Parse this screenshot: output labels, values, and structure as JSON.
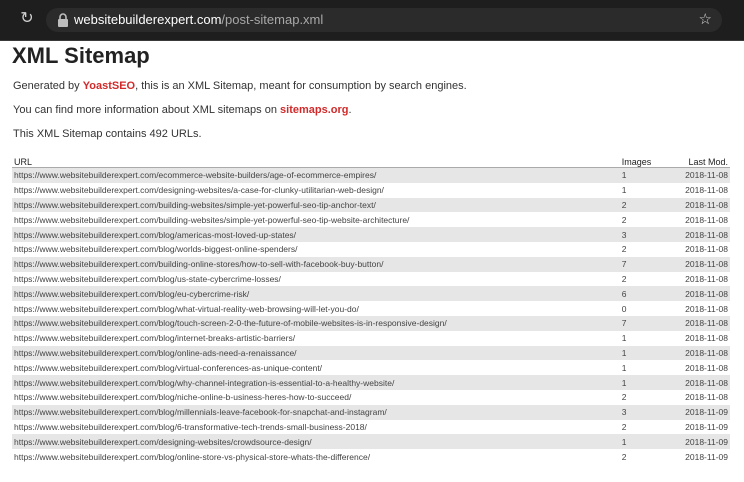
{
  "browser": {
    "url_host": "websitebuilderexpert.com",
    "url_path": "/post-sitemap.xml"
  },
  "page": {
    "title": "XML Sitemap",
    "generated_prefix": "Generated by ",
    "generated_link": "YoastSEO",
    "generated_suffix": ", this is an XML Sitemap, meant for consumption by search engines.",
    "info_prefix": "You can find more information about XML sitemaps on ",
    "info_link": "sitemaps.org",
    "info_suffix": ".",
    "count_text": "This XML Sitemap contains 492 URLs."
  },
  "table": {
    "headers": [
      "URL",
      "Images",
      "Last Mod."
    ],
    "rows": [
      {
        "url": "https://www.websitebuilderexpert.com/ecommerce-website-builders/age-of-ecommerce-empires/",
        "images": "1",
        "lastmod": "2018-11-08"
      },
      {
        "url": "https://www.websitebuilderexpert.com/designing-websites/a-case-for-clunky-utilitarian-web-design/",
        "images": "1",
        "lastmod": "2018-11-08"
      },
      {
        "url": "https://www.websitebuilderexpert.com/building-websites/simple-yet-powerful-seo-tip-anchor-text/",
        "images": "2",
        "lastmod": "2018-11-08"
      },
      {
        "url": "https://www.websitebuilderexpert.com/building-websites/simple-yet-powerful-seo-tip-website-architecture/",
        "images": "2",
        "lastmod": "2018-11-08"
      },
      {
        "url": "https://www.websitebuilderexpert.com/blog/americas-most-loved-up-states/",
        "images": "3",
        "lastmod": "2018-11-08"
      },
      {
        "url": "https://www.websitebuilderexpert.com/blog/worlds-biggest-online-spenders/",
        "images": "2",
        "lastmod": "2018-11-08"
      },
      {
        "url": "https://www.websitebuilderexpert.com/building-online-stores/how-to-sell-with-facebook-buy-button/",
        "images": "7",
        "lastmod": "2018-11-08"
      },
      {
        "url": "https://www.websitebuilderexpert.com/blog/us-state-cybercrime-losses/",
        "images": "2",
        "lastmod": "2018-11-08"
      },
      {
        "url": "https://www.websitebuilderexpert.com/blog/eu-cybercrime-risk/",
        "images": "6",
        "lastmod": "2018-11-08"
      },
      {
        "url": "https://www.websitebuilderexpert.com/blog/what-virtual-reality-web-browsing-will-let-you-do/",
        "images": "0",
        "lastmod": "2018-11-08"
      },
      {
        "url": "https://www.websitebuilderexpert.com/blog/touch-screen-2-0-the-future-of-mobile-websites-is-in-responsive-design/",
        "images": "7",
        "lastmod": "2018-11-08"
      },
      {
        "url": "https://www.websitebuilderexpert.com/blog/internet-breaks-artistic-barriers/",
        "images": "1",
        "lastmod": "2018-11-08"
      },
      {
        "url": "https://www.websitebuilderexpert.com/blog/online-ads-need-a-renaissance/",
        "images": "1",
        "lastmod": "2018-11-08"
      },
      {
        "url": "https://www.websitebuilderexpert.com/blog/virtual-conferences-as-unique-content/",
        "images": "1",
        "lastmod": "2018-11-08"
      },
      {
        "url": "https://www.websitebuilderexpert.com/blog/why-channel-integration-is-essential-to-a-healthy-website/",
        "images": "1",
        "lastmod": "2018-11-08"
      },
      {
        "url": "https://www.websitebuilderexpert.com/blog/niche-online-b-usiness-heres-how-to-succeed/",
        "images": "2",
        "lastmod": "2018-11-08"
      },
      {
        "url": "https://www.websitebuilderexpert.com/blog/millennials-leave-facebook-for-snapchat-and-instagram/",
        "images": "3",
        "lastmod": "2018-11-09"
      },
      {
        "url": "https://www.websitebuilderexpert.com/blog/6-transformative-tech-trends-small-business-2018/",
        "images": "2",
        "lastmod": "2018-11-09"
      },
      {
        "url": "https://www.websitebuilderexpert.com/designing-websites/crowdsource-design/",
        "images": "1",
        "lastmod": "2018-11-09"
      },
      {
        "url": "https://www.websitebuilderexpert.com/blog/online-store-vs-physical-store-whats-the-difference/",
        "images": "2",
        "lastmod": "2018-11-09"
      }
    ]
  }
}
